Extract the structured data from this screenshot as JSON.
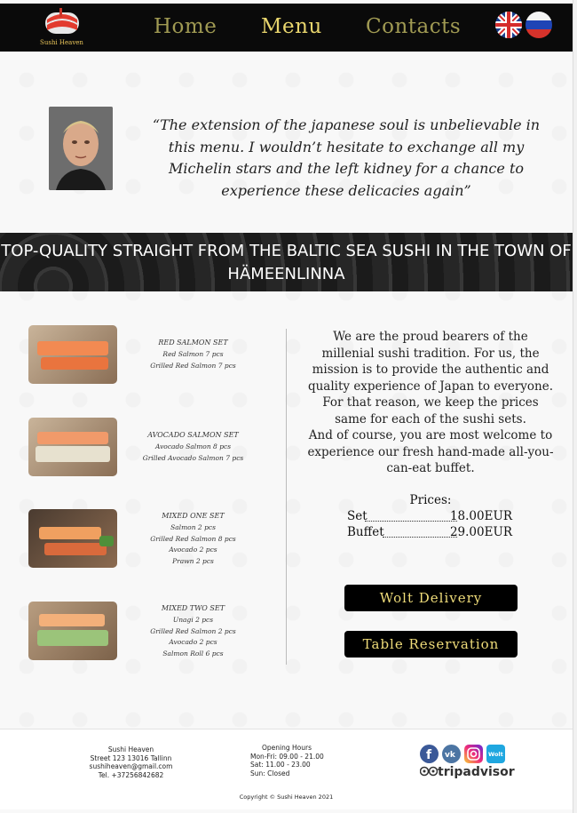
{
  "header": {
    "logo_text": "Sushi Heaven",
    "nav": [
      "Home",
      "Menu",
      "Contacts"
    ]
  },
  "quote": {
    "text": "“The extension of the japanese soul is unbelievable in this menu. I wouldn’t hesitate to exchange all my Michelin stars and the left kidney for a chance to experience these delicacies again”"
  },
  "banner": {
    "text": "TOP-QUALITY STRAIGHT FROM THE BALTIC SEA SUSHI IN THE TOWN OF HÄMEENLINNA"
  },
  "sets": [
    {
      "title": "RED SALMON SET",
      "items": [
        "Red Salmon 7 pcs",
        "Grilled Red Salmon 7 pcs"
      ]
    },
    {
      "title": "AVOCADO SALMON SET",
      "items": [
        "Avocado Salmon 8 pcs",
        "Grilled Avocado Salmon 7 pcs"
      ]
    },
    {
      "title": "MIXED ONE SET",
      "items": [
        "Salmon 2 pcs",
        "Grilled Red Salmon 8 pcs",
        "Avocado 2 pcs",
        "Prawn 2 pcs"
      ]
    },
    {
      "title": "MIXED TWO SET",
      "items": [
        "Unagi 2 pcs",
        "Grilled Red Salmon 2 pcs",
        "Avocado 2 pcs",
        "Salmon Roll 6 pcs"
      ]
    }
  ],
  "about": {
    "p1": "We are the proud bearers of the millenial sushi tradition. For us, the mission is to provide the authentic and quality experience of Japan to everyone. For that reason, we keep the prices same for each of the sushi sets.",
    "p2": "And of course, you are most welcome to experience our fresh hand-made all-you-can-eat buffet."
  },
  "prices": {
    "title": "Prices:",
    "rows": [
      {
        "label": "Set",
        "value": "18.00EUR"
      },
      {
        "label": "Buffet",
        "value": "29.00EUR"
      }
    ]
  },
  "buttons": {
    "wolt": "Wolt Delivery",
    "reservation": "Table Reservation"
  },
  "footer": {
    "contact": [
      "Sushi Heaven",
      "Street 123 13016 Tallinn",
      "sushiheaven@gmail.com",
      "Tel. +37256842682"
    ],
    "hours": [
      "Opening Hours",
      "Mon-Fri: 09.00 - 21.00",
      "Sat: 11.00 - 23.00",
      "Sun: Closed"
    ],
    "social": [
      "facebook-icon",
      "vk-icon",
      "instagram-icon",
      "wolt-icon"
    ],
    "tripadvisor": "tripadvisor",
    "wolt_badge": "Wolt",
    "copyright": "Copyright © Sushi Heaven 2021"
  },
  "colors": {
    "header_bg": "#0a0a0a",
    "nav_gold": "#a09a53",
    "nav_active": "#e8d56d",
    "button_text": "#f0dd7a"
  }
}
